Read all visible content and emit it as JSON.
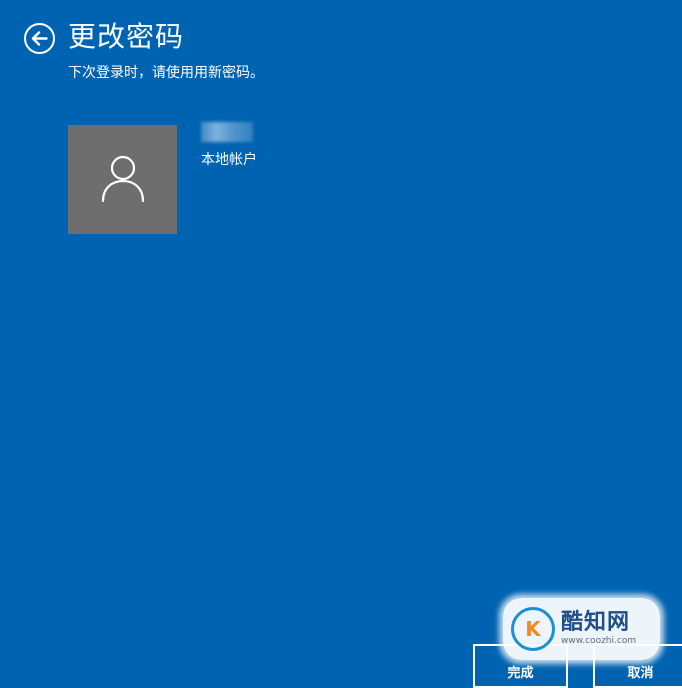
{
  "header": {
    "back_icon": "back-arrow-icon",
    "title": "更改密码",
    "subtitle": "下次登录时，请使用用新密码。"
  },
  "account": {
    "avatar_icon": "user-icon",
    "type": "本地帐户"
  },
  "buttons": {
    "finish_label": "完成",
    "cancel_label": "取消"
  },
  "watermark": {
    "brand": "酷知网",
    "url": "www.coozhi.com"
  },
  "colors": {
    "background": "#0063B1",
    "avatar_tile": "#6e6e6e",
    "text": "#ffffff"
  }
}
